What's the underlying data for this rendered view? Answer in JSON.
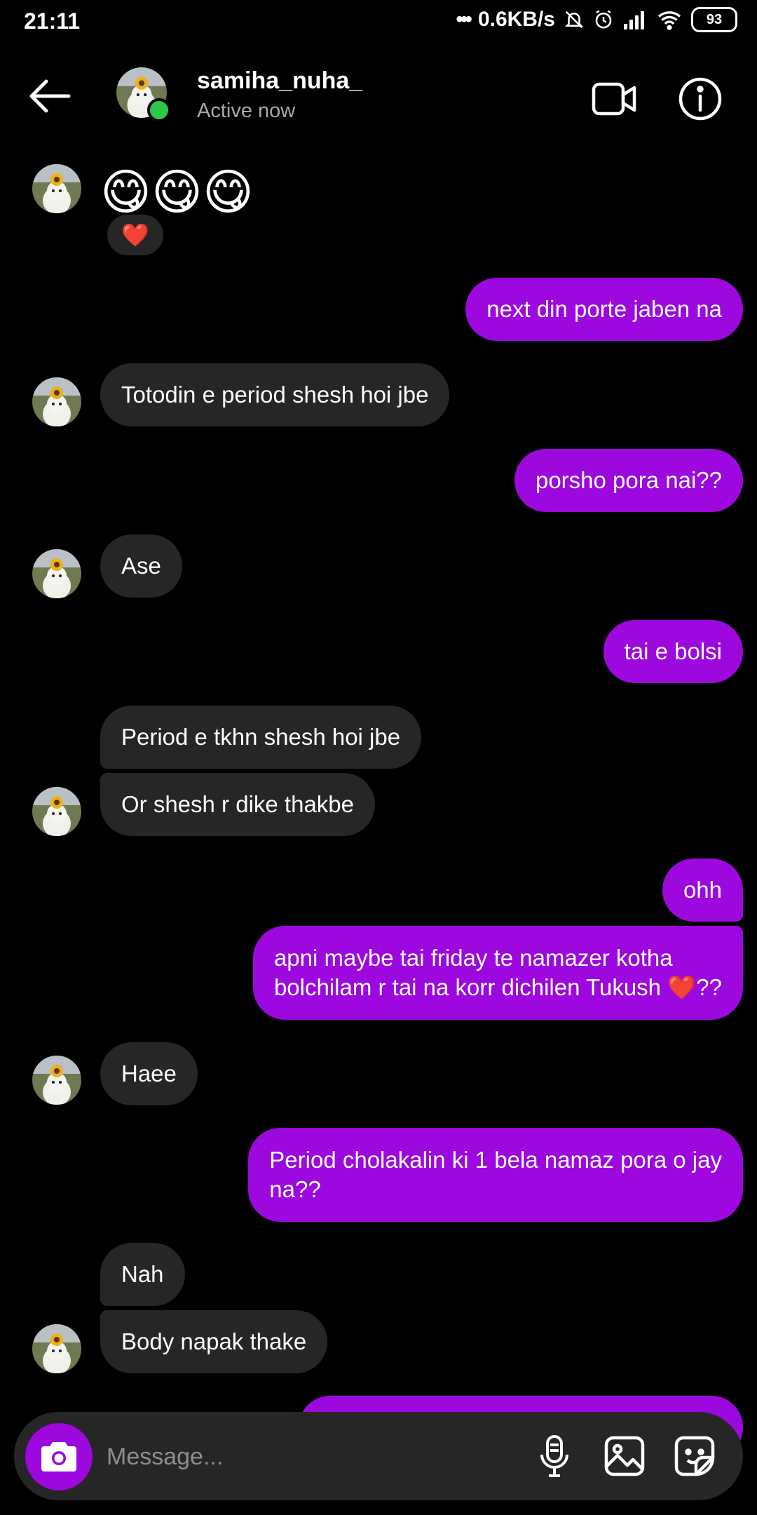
{
  "status": {
    "time": "21:11",
    "speed": "0.6KB/s",
    "battery": "93"
  },
  "header": {
    "contact_name": "samiha_nuha_",
    "contact_status": "Active now"
  },
  "messages": {
    "m1": "😋😋😋",
    "m1_reaction": "❤️",
    "m2": "next din porte jaben na",
    "m3": "Totodin e period shesh hoi jbe",
    "m4": "porsho pora nai??",
    "m5": "Ase",
    "m6": "tai e bolsi",
    "m7": "Period e tkhn shesh hoi jbe",
    "m8": "Or shesh r dike thakbe",
    "m9": "ohh",
    "m10_line1": "apni maybe tai friday te namazer kotha",
    "m10_line2": "bolchilam r tai na korr dichilen Tukush ❤️??",
    "m11": "Haee",
    "m12_line1": "Period cholakalin ki 1 bela namaz pora o jay",
    "m12_line2": "na??",
    "m13": "Nah",
    "m14": "Body napak thake"
  },
  "composer": {
    "placeholder": "Message..."
  },
  "colors": {
    "sent_bubble": "#9c08de",
    "received_bubble": "#262626",
    "online": "#2ec84a"
  }
}
